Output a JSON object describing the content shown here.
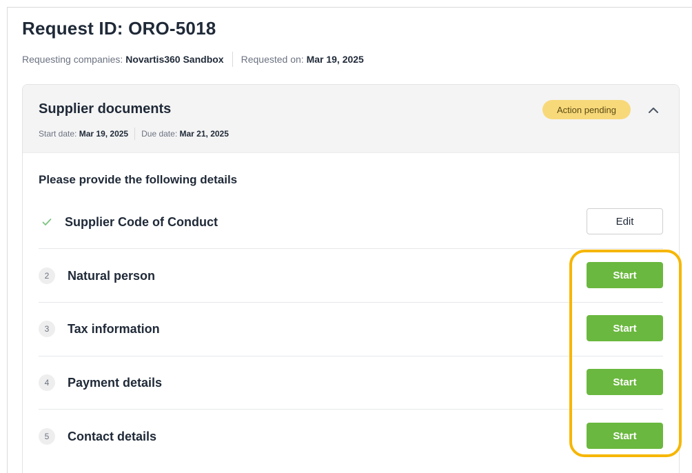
{
  "request": {
    "title": "Request ID: ORO-5018",
    "companies_label": "Requesting companies:",
    "companies_value": "Novartis360 Sandbox",
    "requested_label": "Requested on:",
    "requested_value": "Mar 19, 2025"
  },
  "card": {
    "title": "Supplier documents",
    "start_label": "Start date:",
    "start_value": "Mar 19, 2025",
    "due_label": "Due date:",
    "due_value": "Mar 21, 2025",
    "status": "Action pending",
    "status_color": "#f8d97a",
    "collapse_icon": "chevron-up-icon",
    "section_heading": "Please provide the following details",
    "items": [
      {
        "step": "",
        "label": "Supplier Code of Conduct",
        "completed": true,
        "action": "Edit",
        "icon": "check-icon"
      },
      {
        "step": "2",
        "label": "Natural person",
        "completed": false,
        "action": "Start"
      },
      {
        "step": "3",
        "label": "Tax information",
        "completed": false,
        "action": "Start"
      },
      {
        "step": "4",
        "label": "Payment details",
        "completed": false,
        "action": "Start"
      },
      {
        "step": "5",
        "label": "Contact details",
        "completed": false,
        "action": "Start"
      }
    ]
  },
  "colors": {
    "start_button": "#6ab83f",
    "highlight": "#f6b600",
    "check": "#7cc47f"
  }
}
